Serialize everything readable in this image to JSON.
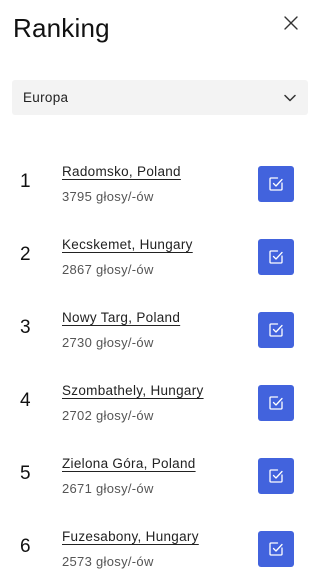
{
  "header": {
    "title": "Ranking"
  },
  "region_select": {
    "value": "Europa"
  },
  "ranking": [
    {
      "rank": "1",
      "city": "Radomsko, Poland",
      "votes": "3795 głosy/-ów"
    },
    {
      "rank": "2",
      "city": "Kecskemet, Hungary",
      "votes": "2867 głosy/-ów"
    },
    {
      "rank": "3",
      "city": "Nowy Targ, Poland",
      "votes": "2730 głosy/-ów"
    },
    {
      "rank": "4",
      "city": "Szombathely, Hungary",
      "votes": "2702 głosy/-ów"
    },
    {
      "rank": "5",
      "city": "Zielona Góra, Poland",
      "votes": "2671 głosy/-ów"
    },
    {
      "rank": "6",
      "city": "Fuzesabony, Hungary",
      "votes": "2573 głosy/-ów"
    }
  ],
  "colors": {
    "accent": "#4263dd",
    "select_bg": "#f3f3f3"
  },
  "icons": {
    "close": "close-icon",
    "dropdown": "chevron-down-icon",
    "vote": "check-square-icon"
  }
}
